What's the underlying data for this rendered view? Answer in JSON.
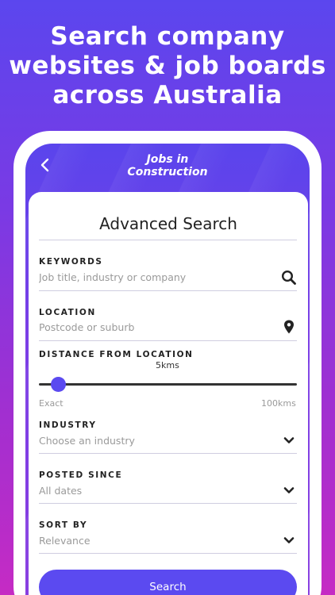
{
  "headline": {
    "line1": "Search company",
    "line2": "websites & job boards",
    "line3": "across Australia"
  },
  "app": {
    "logo_line1": "Jobs in",
    "logo_line2": "Construction"
  },
  "form": {
    "title": "Advanced Search",
    "keywords": {
      "label": "KEYWORDS",
      "placeholder": "Job title, industry or company"
    },
    "location": {
      "label": "LOCATION",
      "placeholder": "Postcode or suburb"
    },
    "distance": {
      "label": "DISTANCE FROM LOCATION",
      "value": "5kms",
      "min_label": "Exact",
      "max_label": "100kms",
      "level_fraction": 0.05
    },
    "industry": {
      "label": "INDUSTRY",
      "value": "Choose an industry"
    },
    "posted_since": {
      "label": "POSTED SINCE",
      "value": "All dates"
    },
    "sort_by": {
      "label": "SORT BY",
      "value": "Relevance"
    },
    "search_label": "Search"
  },
  "colors": {
    "accent": "#5b4af0",
    "background_top": "#5b46ee",
    "background_bottom": "#c52bc4"
  },
  "icons": {
    "back": "chevron-left-icon",
    "search": "search-icon",
    "location": "map-pin-icon",
    "dropdown": "chevron-down-icon"
  }
}
